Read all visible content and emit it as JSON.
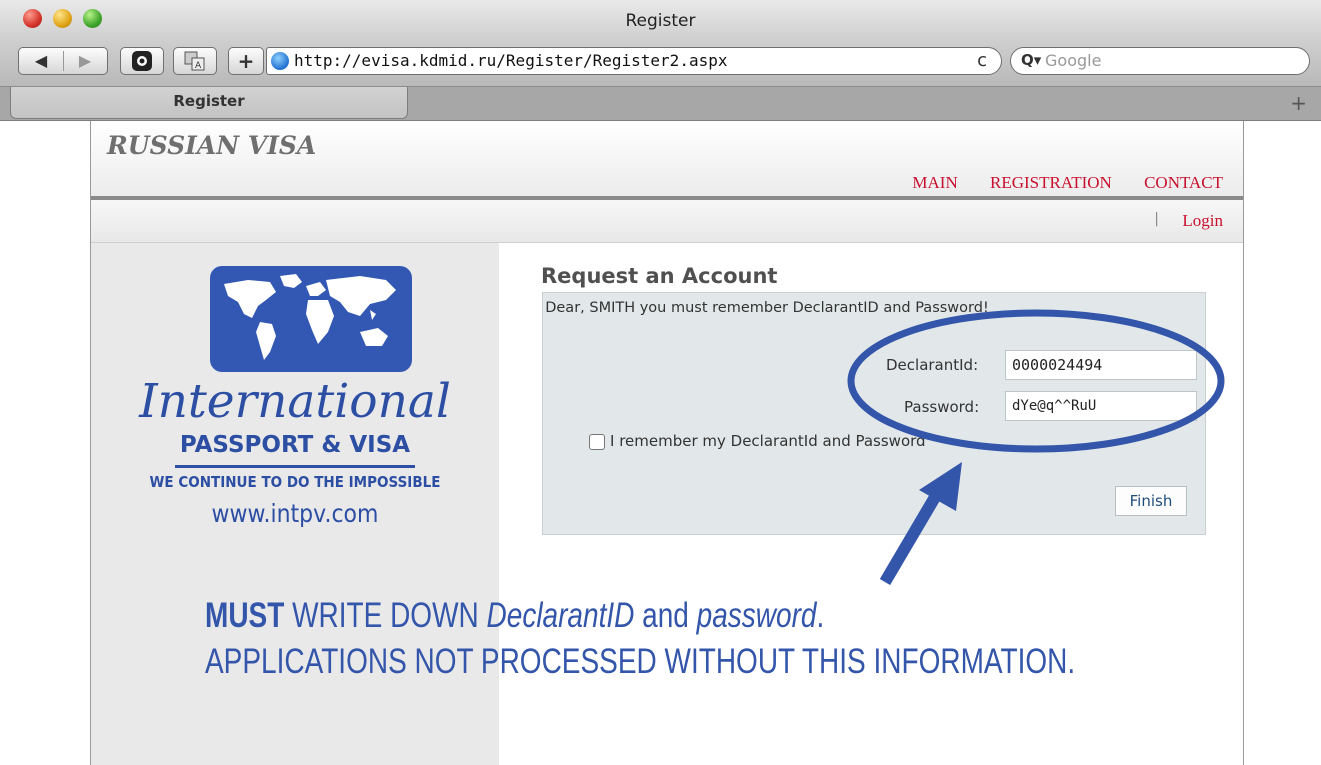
{
  "window": {
    "title": "Register"
  },
  "toolbar": {
    "url": "http://evisa.kdmid.ru/Register/Register2.aspx",
    "search_placeholder": "Google",
    "back_icon": "◀",
    "forward_icon": "▶",
    "add_icon": "+",
    "reload_icon": "c"
  },
  "tabs": [
    {
      "label": "Register"
    }
  ],
  "site": {
    "title": "RUSSIAN VISA",
    "nav": [
      "MAIN",
      "REGISTRATION",
      "CONTACT"
    ],
    "login": "Login",
    "sub_separator": "|"
  },
  "brand": {
    "script": "International",
    "line1": "PASSPORT & VISA",
    "line2": "WE CONTINUE TO DO THE IMPOSSIBLE",
    "url": "www.intpv.com"
  },
  "form": {
    "title": "Request an Account",
    "message": "Dear, SMITH you must remember DeclarantID and Password!",
    "declarant_label": "DeclarantId:",
    "declarant_value": "0000024494",
    "password_label": "Password:",
    "password_value": "dYe@q^^RuU",
    "remember_label": "I remember my DeclarantId and Password",
    "finish_label": "Finish"
  },
  "annotation": {
    "must": "MUST",
    "write_down": " WRITE DOWN ",
    "declarant": "DeclarantID",
    "and": " and ",
    "password": "password",
    "period": ".",
    "line2": "APPLICATIONS NOT PROCESSED WITHOUT THIS INFORMATION."
  },
  "colors": {
    "nav_red": "#c8102e",
    "brand_blue": "#2c4ea3",
    "annotation_blue": "#3355aa",
    "panel": "#e2e8e9"
  },
  "icons": {
    "globe": "globe-icon",
    "search": "search-icon",
    "reload": "reload-icon",
    "world_map": "world-map-icon"
  }
}
